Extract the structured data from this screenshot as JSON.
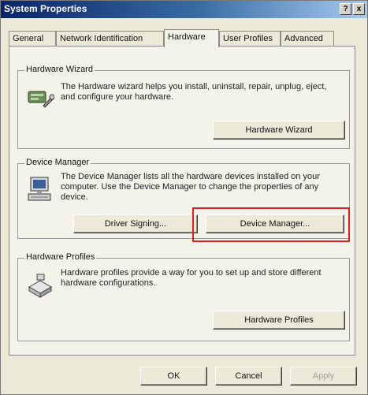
{
  "window": {
    "title": "System Properties",
    "help_button": "?",
    "close_button": "x"
  },
  "tabs": [
    {
      "label": "General",
      "active": false
    },
    {
      "label": "Network Identification",
      "active": false
    },
    {
      "label": "Hardware",
      "active": true
    },
    {
      "label": "User Profiles",
      "active": false
    },
    {
      "label": "Advanced",
      "active": false
    }
  ],
  "hardware_wizard": {
    "group_label": "Hardware Wizard",
    "description": "The Hardware wizard helps you install, uninstall, repair, unplug, eject, and configure your hardware.",
    "button": "Hardware Wizard"
  },
  "device_manager": {
    "group_label": "Device Manager",
    "description": "The Device Manager lists all the hardware devices installed on your computer. Use the Device Manager to change the properties of any device.",
    "driver_signing_button": "Driver Signing...",
    "device_manager_button": "Device Manager..."
  },
  "hardware_profiles": {
    "group_label": "Hardware Profiles",
    "description": "Hardware profiles provide a way for you to set up and store different hardware configurations.",
    "button": "Hardware Profiles"
  },
  "footer": {
    "ok": "OK",
    "cancel": "Cancel",
    "apply": "Apply"
  },
  "colors": {
    "highlight": "#e02020",
    "title_bar": "#0a246a"
  }
}
